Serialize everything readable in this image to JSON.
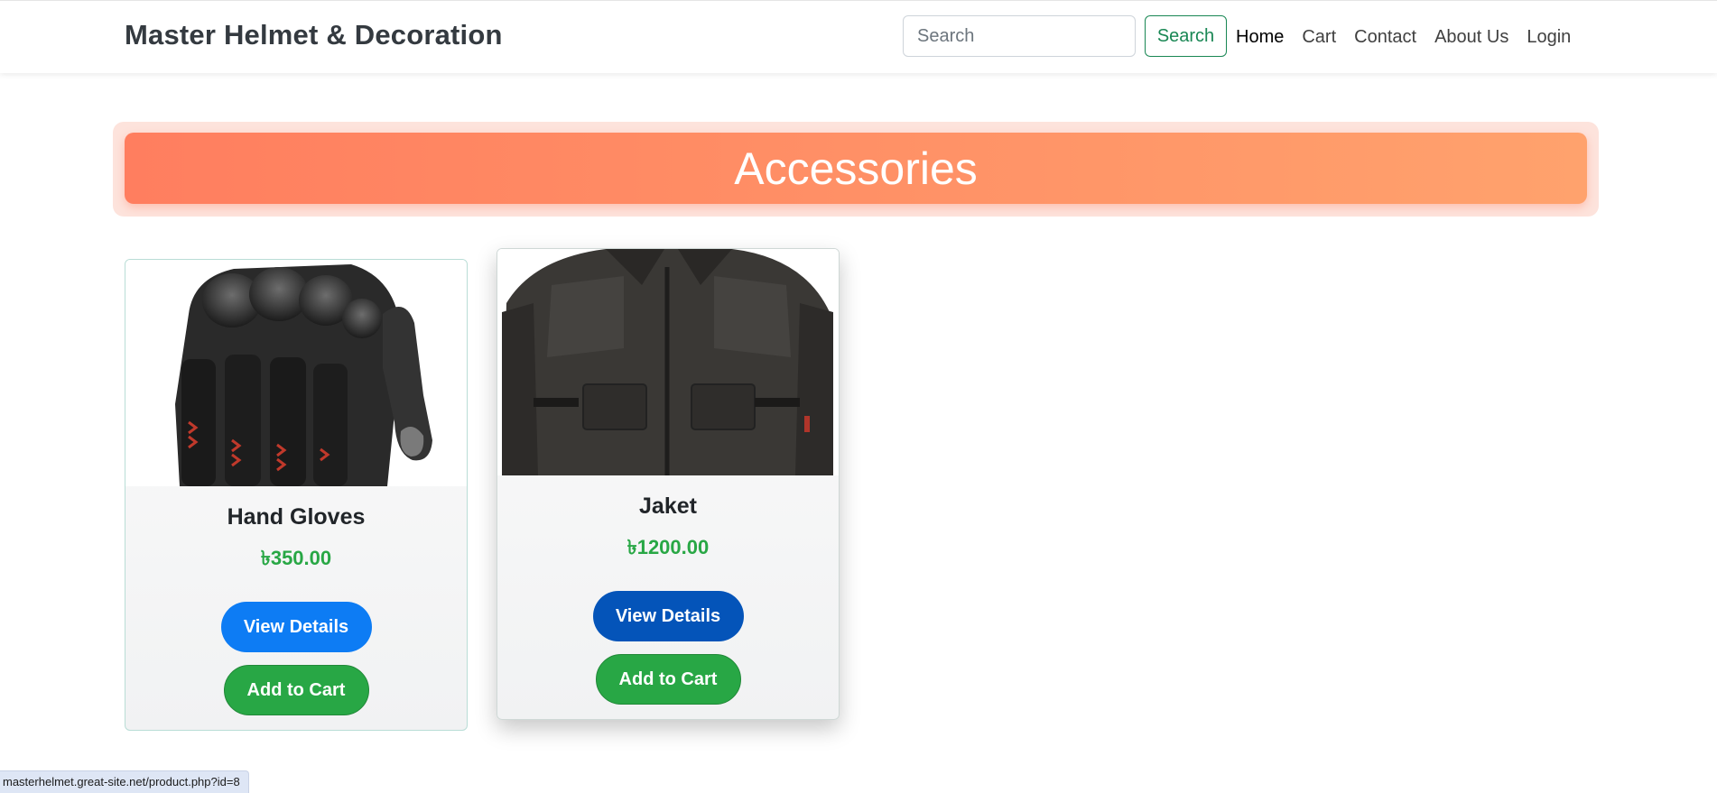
{
  "navbar": {
    "brand": "Master Helmet & Decoration",
    "search_placeholder": "Search",
    "search_button": "Search",
    "links": [
      {
        "label": "Home",
        "active": true
      },
      {
        "label": "Cart",
        "active": false
      },
      {
        "label": "Contact",
        "active": false
      },
      {
        "label": "About Us",
        "active": false
      },
      {
        "label": "Login",
        "active": false
      }
    ]
  },
  "banner": {
    "title": "Accessories"
  },
  "products": [
    {
      "name": "Hand Gloves",
      "price": "৳350.00",
      "image_icon": "gloves-image",
      "details_label": "View Details",
      "cart_label": "Add to Cart"
    },
    {
      "name": "Jaket",
      "price": "৳1200.00",
      "image_icon": "jacket-image",
      "details_label": "View Details",
      "cart_label": "Add to Cart"
    }
  ],
  "status_bar": {
    "url": "masterhelmet.great-site.net/product.php?id=8"
  },
  "colors": {
    "accent_green": "#198754",
    "price_green": "#28a745",
    "primary_blue": "#0d7cf4",
    "banner_start": "#ff7e5f",
    "banner_end": "#ffa26d"
  }
}
